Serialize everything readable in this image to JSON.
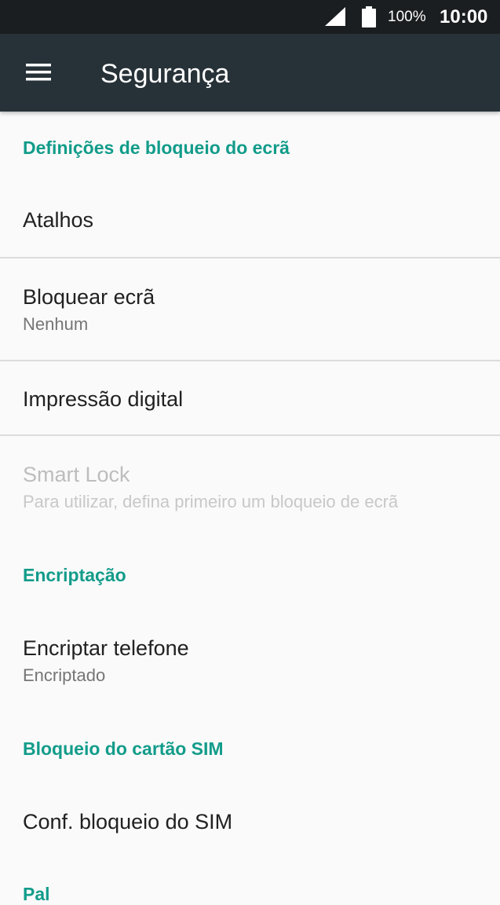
{
  "status_bar": {
    "signal_icon": "cellular-signal-icon",
    "battery_icon": "battery-full-icon",
    "battery_percent": "100%",
    "time": "10:00"
  },
  "app_bar": {
    "menu_icon": "hamburger-menu-icon",
    "title": "Segurança"
  },
  "sections": {
    "lock_screen": {
      "header": "Definições de bloqueio do ecrã",
      "items": [
        {
          "label": "Atalhos"
        },
        {
          "label": "Bloquear ecrã",
          "summary": "Nenhum"
        },
        {
          "label": "Impressão digital"
        },
        {
          "label": "Smart Lock",
          "summary": "Para utilizar, defina primeiro um bloqueio de ecrã",
          "enabled": false
        }
      ]
    },
    "encryption": {
      "header": "Encriptação",
      "items": [
        {
          "label": "Encriptar telefone",
          "summary": "Encriptado"
        }
      ]
    },
    "sim_lock": {
      "header": "Bloqueio do cartão SIM",
      "items": [
        {
          "label": "Conf. bloqueio do SIM"
        }
      ]
    },
    "next_section": {
      "header": "Pal"
    }
  },
  "colors": {
    "status_bar_bg": "#1b1e20",
    "app_bar_bg": "#273238",
    "accent": "#129c8a",
    "background": "#fafafa",
    "primary_text": "#212121",
    "secondary_text": "#757575",
    "disabled_text": "#bdbdbd",
    "divider": "#dcdcdc"
  }
}
